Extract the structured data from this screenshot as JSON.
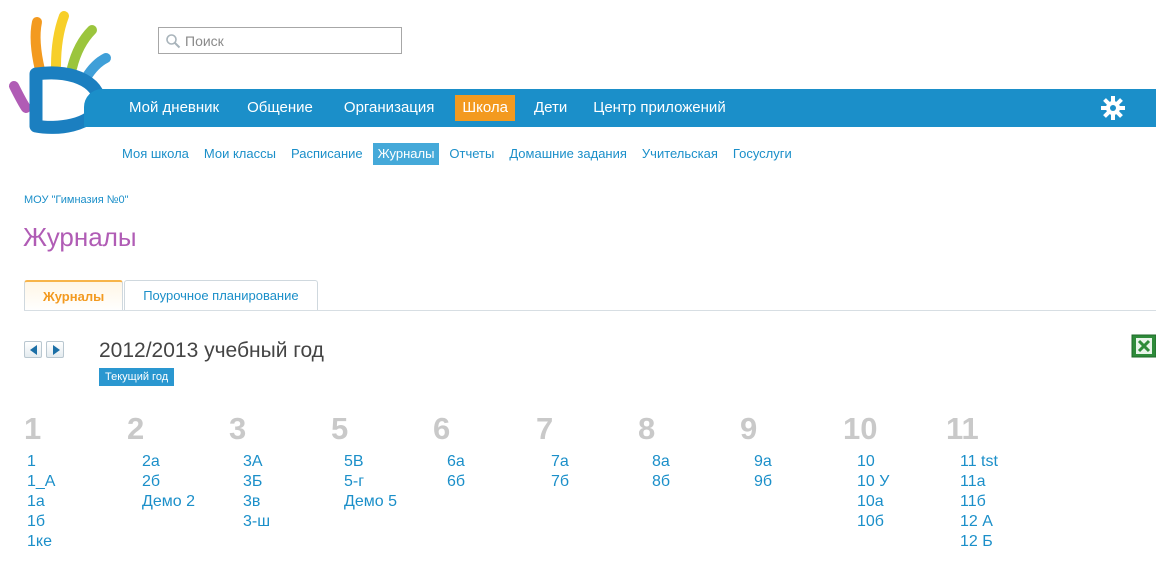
{
  "search": {
    "placeholder": "Поиск"
  },
  "main_nav": [
    {
      "label": "Мой дневник",
      "active": false
    },
    {
      "label": "Общение",
      "active": false
    },
    {
      "label": "Организация",
      "active": false
    },
    {
      "label": "Школа",
      "active": true
    },
    {
      "label": "Дети",
      "active": false
    },
    {
      "label": "Центр приложений",
      "active": false
    }
  ],
  "sub_nav": [
    {
      "label": "Моя школа",
      "active": false
    },
    {
      "label": "Мои классы",
      "active": false
    },
    {
      "label": "Расписание",
      "active": false
    },
    {
      "label": "Журналы",
      "active": true
    },
    {
      "label": "Отчеты",
      "active": false
    },
    {
      "label": "Домашние задания",
      "active": false
    },
    {
      "label": "Учительская",
      "active": false
    },
    {
      "label": "Госуслуги",
      "active": false
    }
  ],
  "breadcrumb": "МОУ \"Гимназия №0\"",
  "page_title": "Журналы",
  "tabs": [
    {
      "label": "Журналы",
      "active": true
    },
    {
      "label": "Поурочное планирование",
      "active": false
    }
  ],
  "year": {
    "title": "2012/2013 учебный год",
    "badge": "Текущий год"
  },
  "grades": [
    {
      "number": "1",
      "classes": [
        "1",
        "1_А",
        "1а",
        "1б",
        "1ке"
      ]
    },
    {
      "number": "2",
      "classes": [
        "2а",
        "2б",
        "Демо 2"
      ]
    },
    {
      "number": "3",
      "classes": [
        "3А",
        "3Б",
        "3в",
        "3-ш"
      ]
    },
    {
      "number": "5",
      "classes": [
        "5В",
        "5-г",
        "Демо 5"
      ]
    },
    {
      "number": "6",
      "classes": [
        "6а",
        "6б"
      ]
    },
    {
      "number": "7",
      "classes": [
        "7а",
        "7б"
      ]
    },
    {
      "number": "8",
      "classes": [
        "8а",
        "8б"
      ]
    },
    {
      "number": "9",
      "classes": [
        "9а",
        "9б"
      ]
    },
    {
      "number": "10",
      "classes": [
        "10",
        "10 У",
        "10а",
        "10б"
      ]
    },
    {
      "number": "11",
      "classes": [
        "11 tst",
        "11а",
        "11б",
        "12 А",
        "12 Б"
      ]
    }
  ],
  "colors": {
    "brand_blue": "#1b8fc9",
    "accent_orange": "#f39a1f",
    "title_purple": "#b05cb5",
    "grade_gray": "#c9c9c9"
  },
  "icons": {
    "logo": "hand-logo-icon",
    "search": "magnifier-icon",
    "settings": "gear-icon",
    "prev": "arrow-left-icon",
    "next": "arrow-right-icon",
    "export": "excel-icon"
  }
}
